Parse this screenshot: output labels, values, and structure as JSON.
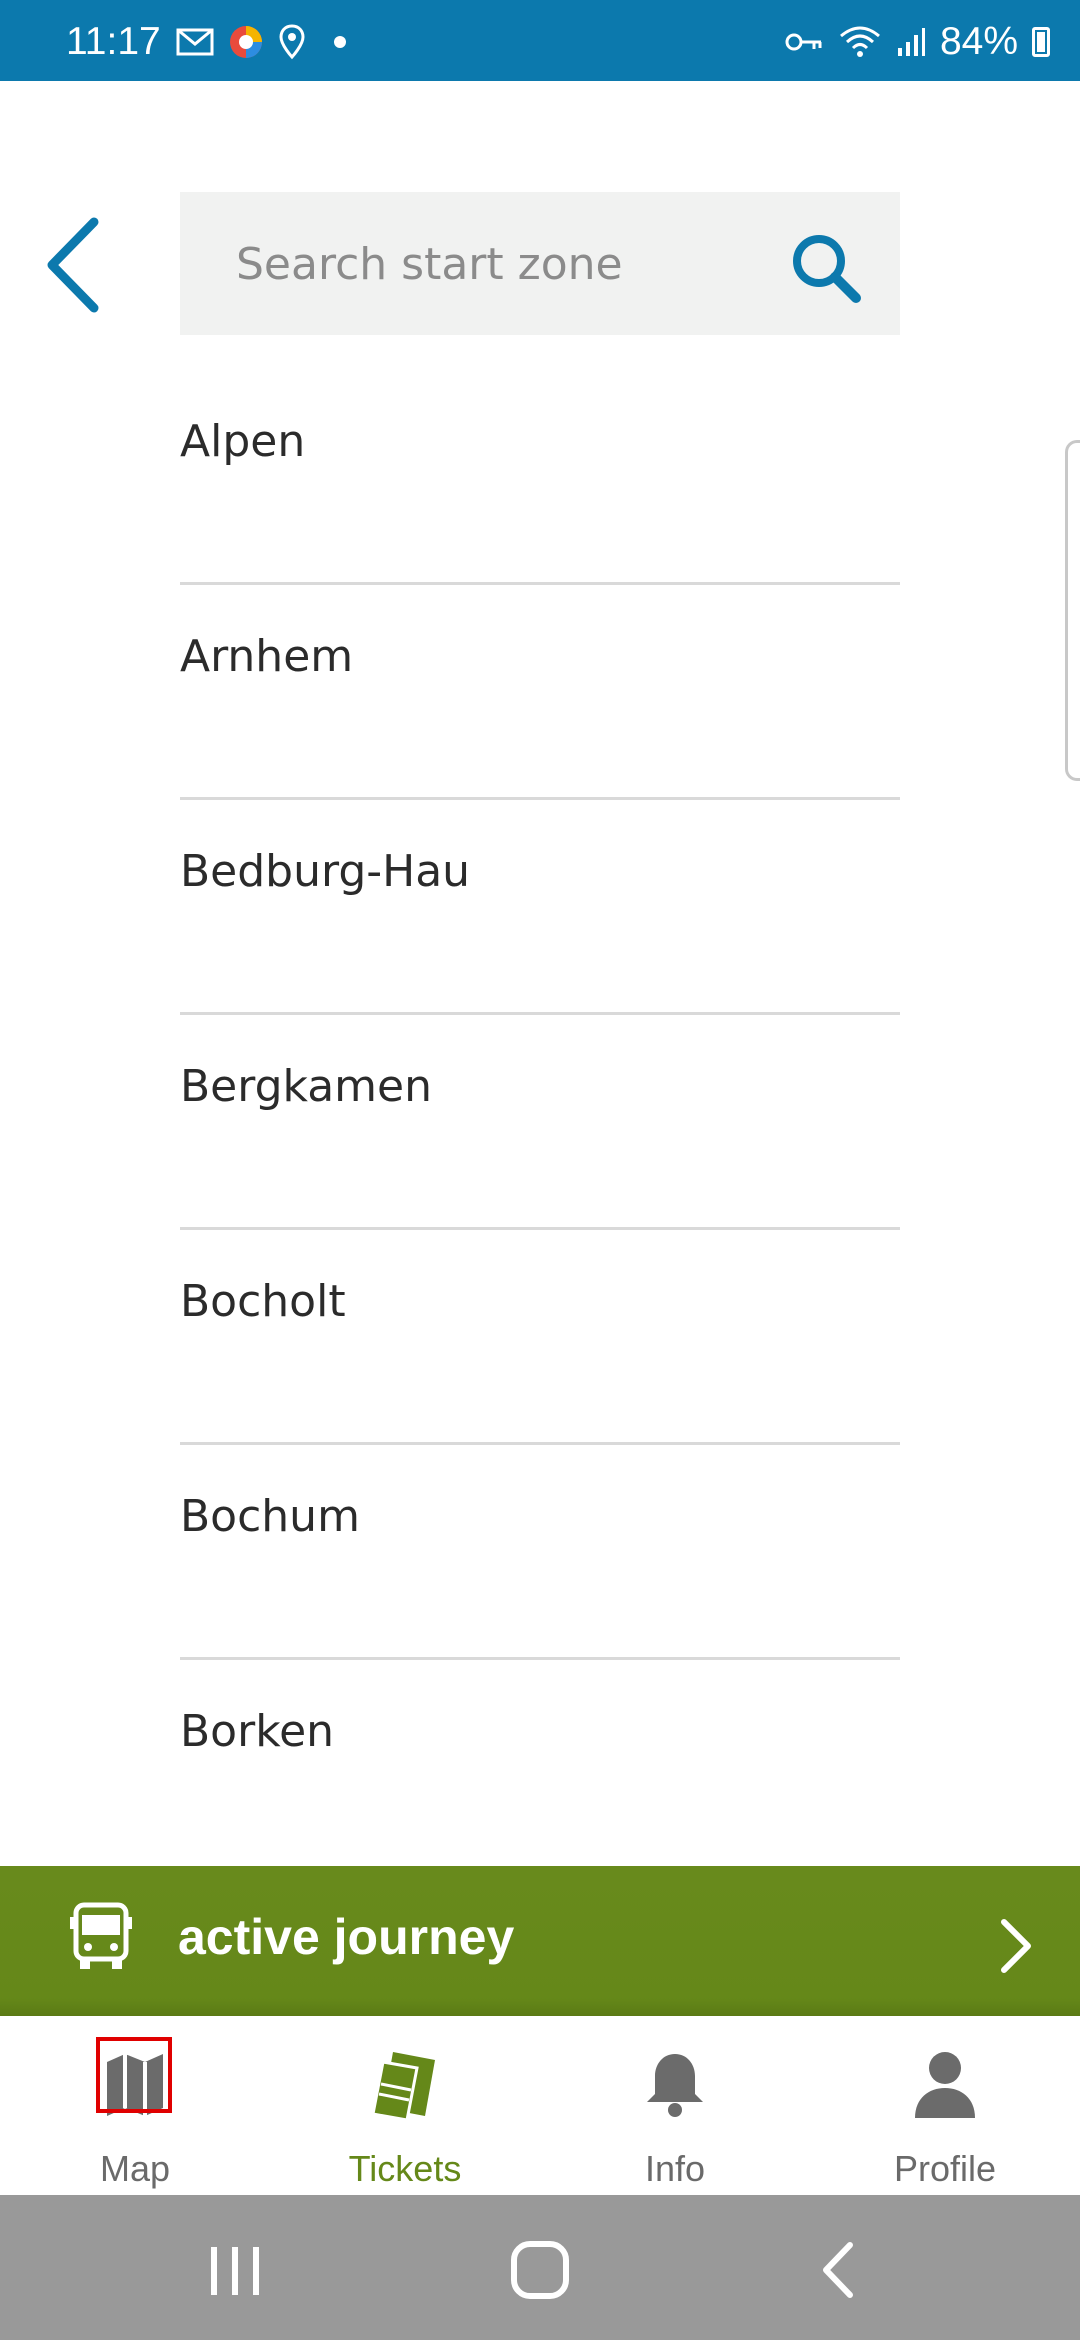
{
  "status_bar": {
    "time": "11:17",
    "battery": "84%",
    "left_icons": [
      "mail-icon",
      "app-icon",
      "location-icon",
      "dot-icon"
    ],
    "right_icons": [
      "vpn-key-icon",
      "wifi-icon",
      "signal-icon",
      "battery-icon"
    ]
  },
  "header": {
    "search_placeholder": "Search start zone"
  },
  "zones": [
    "Alpen",
    "Arnhem",
    "Bedburg-Hau",
    "Bergkamen",
    "Bocholt",
    "Bochum",
    "Borken"
  ],
  "journey_bar": {
    "label": "active journey"
  },
  "bottom_nav": {
    "items": [
      {
        "label": "Map",
        "icon": "map-icon"
      },
      {
        "label": "Tickets",
        "icon": "tickets-icon"
      },
      {
        "label": "Info",
        "icon": "bell-icon"
      },
      {
        "label": "Profile",
        "icon": "person-icon"
      }
    ],
    "active": "Tickets"
  },
  "colors": {
    "primary_blue": "#0c79ad",
    "accent_green": "#658819",
    "focus_red": "#e00000"
  }
}
